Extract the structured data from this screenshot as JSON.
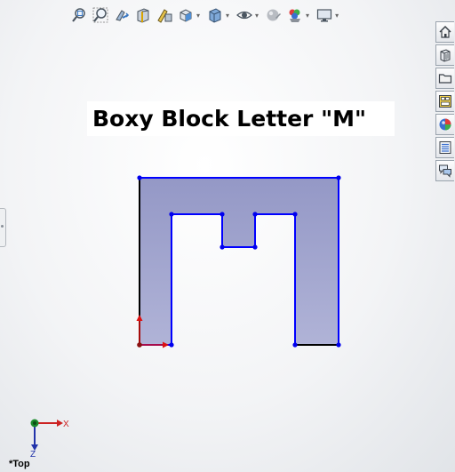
{
  "toolbar": {
    "icons": [
      "zoom-to-fit-icon",
      "zoom-to-area-icon",
      "previous-view-icon",
      "section-view-icon",
      "dynamic-annotation-icon",
      "view-orientation-icon",
      "display-style-icon",
      "hide-show-items-icon",
      "edit-appearance-icon",
      "apply-scene-icon",
      "view-settings-icon"
    ]
  },
  "side_tabs": [
    "home-icon",
    "part-library-icon",
    "file-explorer-icon",
    "view-palette-icon",
    "appearances-icon",
    "custom-properties-icon",
    "forum-icon"
  ],
  "note": {
    "text": "Boxy Block Letter \"M\""
  },
  "sketch": {
    "fill_color": "#9fa4cc",
    "line_color": "#0000ff",
    "point_color": "#0000ee",
    "fixed_line_color": "#000000"
  },
  "triad": {
    "x_label": "X",
    "z_label": "Z"
  },
  "view_label": "*Top",
  "colors": {
    "origin_red": "#dd1111",
    "triad_red": "#cc2222",
    "triad_blue": "#2233aa",
    "triad_green": "#1a8a2a"
  }
}
